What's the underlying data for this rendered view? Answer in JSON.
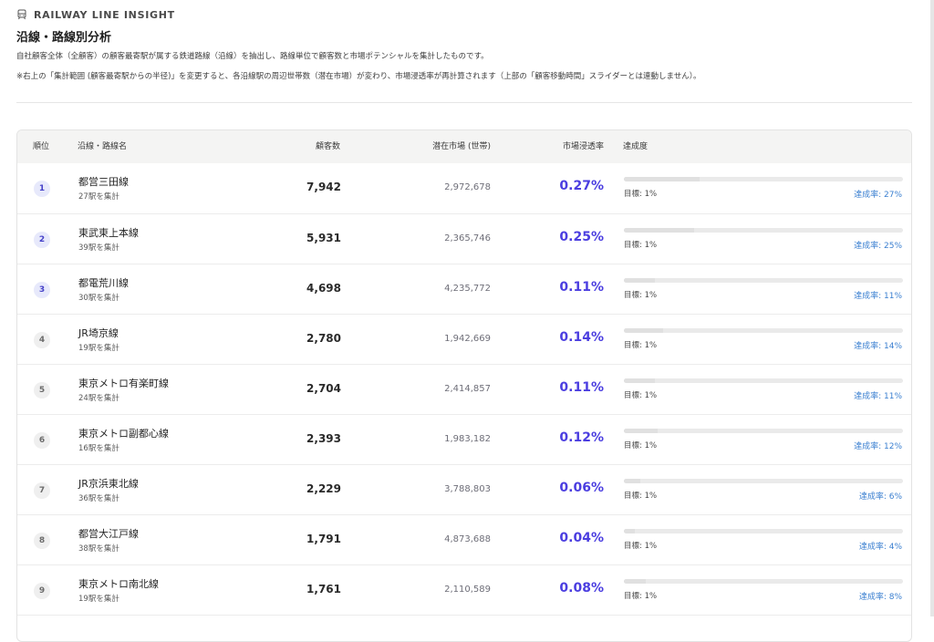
{
  "header": {
    "eyebrow": "RAILWAY LINE INSIGHT",
    "title": "沿線・路線別分析",
    "description": "自社顧客全体（全顧客）の顧客最寄駅が属する鉄道路線（沿線）を抽出し、路線単位で顧客数と市場ポテンシャルを集計したものです。",
    "note": "※右上の「集計範囲 (顧客最寄駅からの半径)」を変更すると、各沿線駅の周辺世帯数（潜在市場）が変わり、市場浸透率が再計算されます（上部の「顧客移動時間」スライダーとは連動しません）。"
  },
  "table": {
    "columns": {
      "rank": "順位",
      "name": "沿線・路線名",
      "customers": "顧客数",
      "market": "潜在市場 (世帯)",
      "penetration": "市場浸透率",
      "achievement": "達成度"
    },
    "rows": [
      {
        "rank": "1",
        "name": "都営三田線",
        "stations": "27駅を集計",
        "customers": "7,942",
        "market": "2,972,678",
        "penetration": "0.27%",
        "target": "目標: 1%",
        "rate": "達成率: 27%",
        "progress": 0.27
      },
      {
        "rank": "2",
        "name": "東武東上本線",
        "stations": "39駅を集計",
        "customers": "5,931",
        "market": "2,365,746",
        "penetration": "0.25%",
        "target": "目標: 1%",
        "rate": "達成率: 25%",
        "progress": 0.25
      },
      {
        "rank": "3",
        "name": "都電荒川線",
        "stations": "30駅を集計",
        "customers": "4,698",
        "market": "4,235,772",
        "penetration": "0.11%",
        "target": "目標: 1%",
        "rate": "達成率: 11%",
        "progress": 0.11
      },
      {
        "rank": "4",
        "name": "JR埼京線",
        "stations": "19駅を集計",
        "customers": "2,780",
        "market": "1,942,669",
        "penetration": "0.14%",
        "target": "目標: 1%",
        "rate": "達成率: 14%",
        "progress": 0.14
      },
      {
        "rank": "5",
        "name": "東京メトロ有楽町線",
        "stations": "24駅を集計",
        "customers": "2,704",
        "market": "2,414,857",
        "penetration": "0.11%",
        "target": "目標: 1%",
        "rate": "達成率: 11%",
        "progress": 0.11
      },
      {
        "rank": "6",
        "name": "東京メトロ副都心線",
        "stations": "16駅を集計",
        "customers": "2,393",
        "market": "1,983,182",
        "penetration": "0.12%",
        "target": "目標: 1%",
        "rate": "達成率: 12%",
        "progress": 0.12
      },
      {
        "rank": "7",
        "name": "JR京浜東北線",
        "stations": "36駅を集計",
        "customers": "2,229",
        "market": "3,788,803",
        "penetration": "0.06%",
        "target": "目標: 1%",
        "rate": "達成率: 6%",
        "progress": 0.06
      },
      {
        "rank": "8",
        "name": "都営大江戸線",
        "stations": "38駅を集計",
        "customers": "1,791",
        "market": "4,873,688",
        "penetration": "0.04%",
        "target": "目標: 1%",
        "rate": "達成率: 4%",
        "progress": 0.04
      },
      {
        "rank": "9",
        "name": "東京メトロ南北線",
        "stations": "19駅を集計",
        "customers": "1,761",
        "market": "2,110,589",
        "penetration": "0.08%",
        "target": "目標: 1%",
        "rate": "達成率: 8%",
        "progress": 0.08
      }
    ]
  },
  "colors": {
    "accent": "#4b3ee0",
    "rate_link": "#3a7fd0",
    "rank_top_bg": "#e7e9fb",
    "header_bg": "#f4f4f3"
  },
  "icons": {
    "eyebrow_icon": "train-icon"
  }
}
